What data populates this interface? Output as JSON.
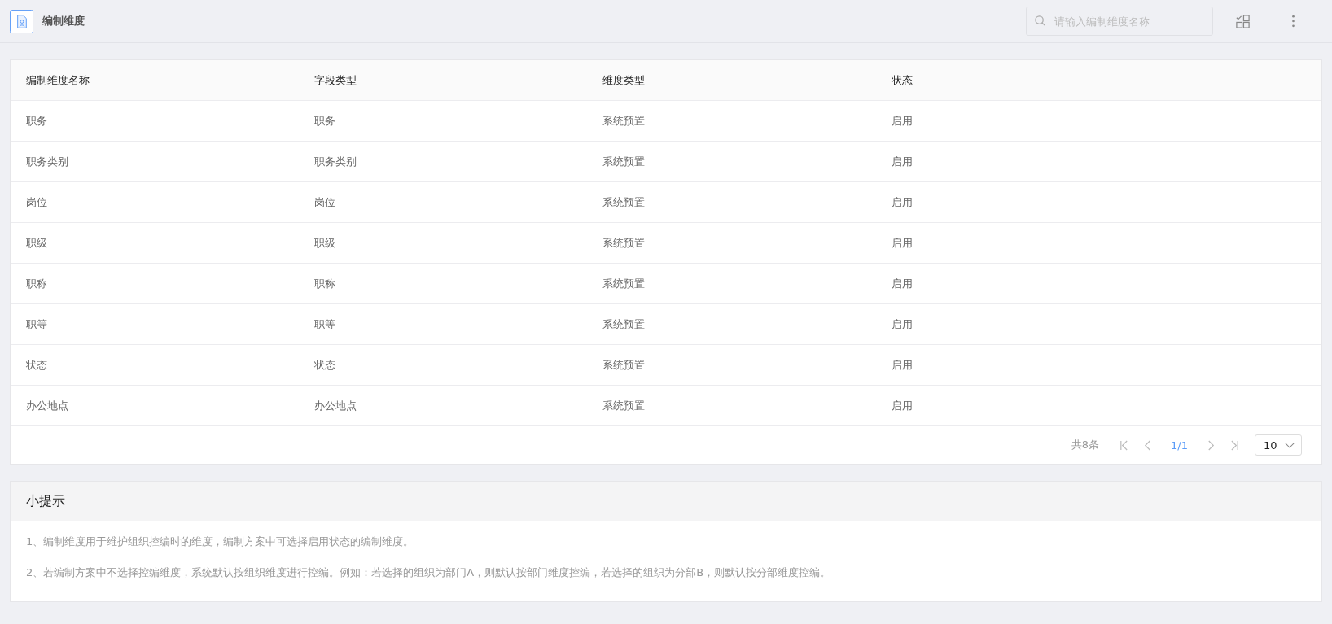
{
  "header": {
    "title": "编制维度",
    "search": {
      "placeholder": "请输入编制维度名称"
    }
  },
  "table": {
    "columns": [
      "编制维度名称",
      "字段类型",
      "维度类型",
      "状态"
    ],
    "rows": [
      [
        "职务",
        "职务",
        "系统预置",
        "启用"
      ],
      [
        "职务类别",
        "职务类别",
        "系统预置",
        "启用"
      ],
      [
        "岗位",
        "岗位",
        "系统预置",
        "启用"
      ],
      [
        "职级",
        "职级",
        "系统预置",
        "启用"
      ],
      [
        "职称",
        "职称",
        "系统预置",
        "启用"
      ],
      [
        "职等",
        "职等",
        "系统预置",
        "启用"
      ],
      [
        "状态",
        "状态",
        "系统预置",
        "启用"
      ],
      [
        "办公地点",
        "办公地点",
        "系统预置",
        "启用"
      ]
    ]
  },
  "pagination": {
    "total": "共8条",
    "page": "1/1",
    "page_size": "10"
  },
  "tips": {
    "title": "小提示",
    "lines": [
      "1、编制维度用于维护组织控编时的维度，编制方案中可选择启用状态的编制维度。",
      "2、若编制方案中不选择控编维度，系统默认按组织维度进行控编。例如：若选择的组织为部门A，则默认按部门维度控编，若选择的组织为分部B，则默认按分部维度控编。"
    ]
  }
}
